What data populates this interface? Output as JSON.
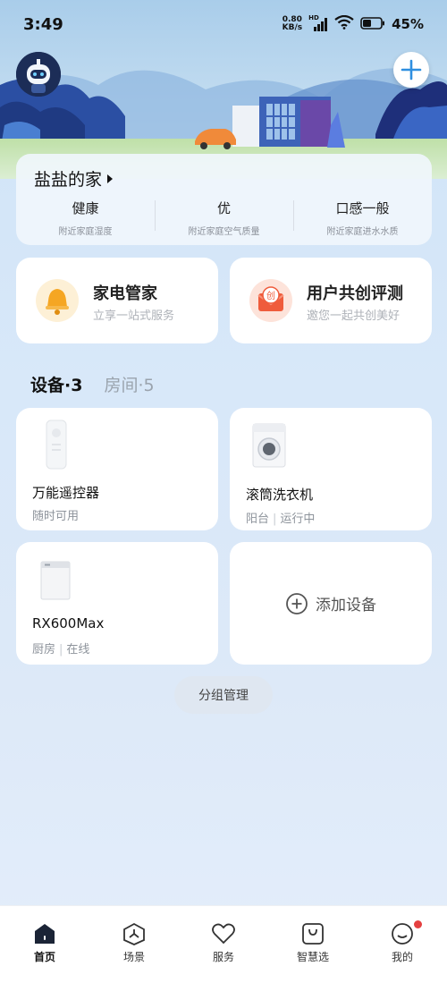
{
  "status_bar": {
    "time": "3:49",
    "net_speed_value": "0.80",
    "net_speed_unit": "KB/s",
    "signal_tag": "HD",
    "battery": "45%"
  },
  "home": {
    "name": "盐盐的家",
    "stats": [
      {
        "value": "健康",
        "label": "附近家庭湿度"
      },
      {
        "value": "优",
        "label": "附近家庭空气质量"
      },
      {
        "value": "口感一般",
        "label": "附近家庭进水水质"
      }
    ]
  },
  "services": [
    {
      "title": "家电管家",
      "subtitle": "立享一站式服务",
      "icon": "bell-icon"
    },
    {
      "title": "用户共创评测",
      "subtitle": "邀您一起共创美好",
      "icon": "create-envelope-icon",
      "icon_text": "创"
    }
  ],
  "tabs": {
    "devices": "设备·3",
    "rooms": "房间·5"
  },
  "devices": [
    {
      "name": "万能遥控器",
      "status": [
        "随时可用"
      ],
      "icon": "remote-control-icon"
    },
    {
      "name": "滚筒洗衣机",
      "status": [
        "阳台",
        "运行中"
      ],
      "icon": "washing-machine-icon"
    },
    {
      "name": "RX600Max",
      "status": [
        "厨房",
        "在线"
      ],
      "icon": "dishwasher-icon"
    }
  ],
  "add_device": "添加设备",
  "group_manage": "分组管理",
  "nav": [
    {
      "label": "首页",
      "icon": "home-icon",
      "active": true
    },
    {
      "label": "场景",
      "icon": "scene-icon"
    },
    {
      "label": "服务",
      "icon": "heart-icon"
    },
    {
      "label": "智慧选",
      "icon": "shopping-bag-icon"
    },
    {
      "label": "我的",
      "icon": "profile-smile-icon",
      "badge": true
    }
  ],
  "colors": {
    "badge": "#e54040",
    "service_orange": "#f5a623",
    "service_red": "#ef5c3c",
    "sky": "#cfe3f7"
  }
}
